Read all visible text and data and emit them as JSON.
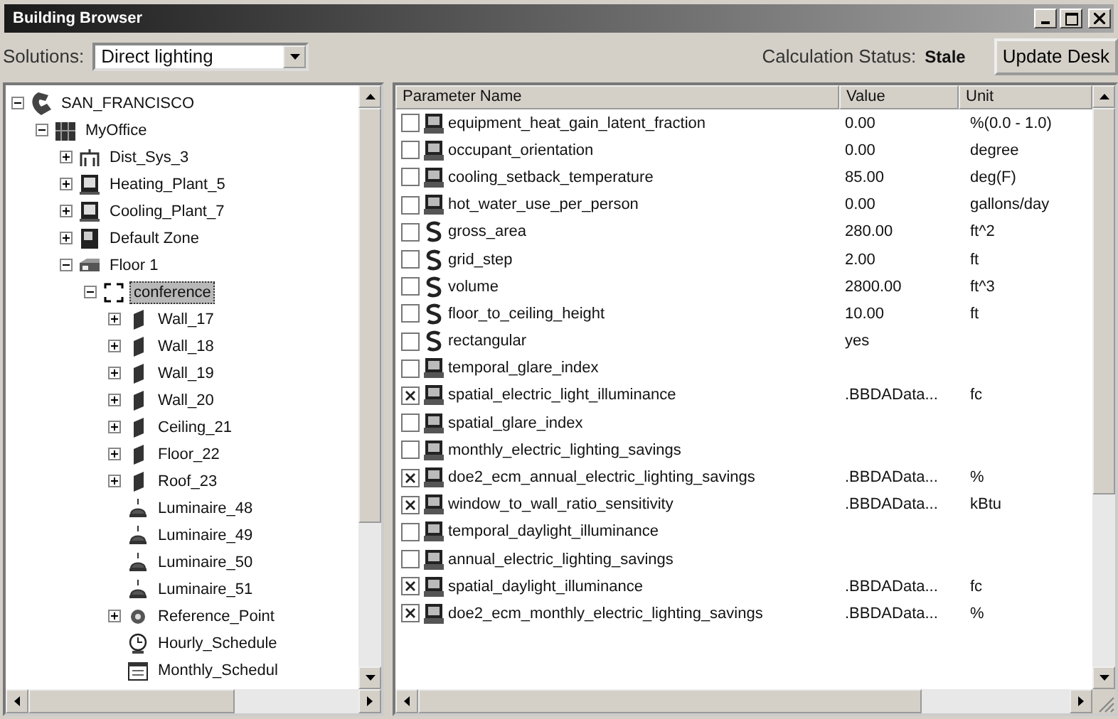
{
  "window": {
    "title": "Building Browser"
  },
  "toolbar": {
    "solutions_label": "Solutions:",
    "solutions_value": "Direct lighting",
    "status_label": "Calculation Status:",
    "status_value": "Stale",
    "update_button": "Update Desk"
  },
  "tree": [
    {
      "label": "SAN_FRANCISCO",
      "kind": "city",
      "expanded": true,
      "selected": false,
      "children": [
        {
          "label": "MyOffice",
          "kind": "building",
          "expanded": true,
          "selected": false,
          "children": [
            {
              "label": "Dist_Sys_3",
              "kind": "system",
              "expanded": false,
              "selected": false
            },
            {
              "label": "Heating_Plant_5",
              "kind": "plant",
              "expanded": false,
              "selected": false
            },
            {
              "label": "Cooling_Plant_7",
              "kind": "plant",
              "expanded": false,
              "selected": false
            },
            {
              "label": "Default Zone",
              "kind": "zone",
              "expanded": false,
              "selected": false
            },
            {
              "label": "Floor 1",
              "kind": "floor",
              "expanded": true,
              "selected": false,
              "children": [
                {
                  "label": "conference",
                  "kind": "space",
                  "expanded": true,
                  "selected": true,
                  "children": [
                    {
                      "label": "Wall_17",
                      "kind": "surface",
                      "expanded": false,
                      "selected": false
                    },
                    {
                      "label": "Wall_18",
                      "kind": "surface",
                      "expanded": false,
                      "selected": false
                    },
                    {
                      "label": "Wall_19",
                      "kind": "surface",
                      "expanded": false,
                      "selected": false
                    },
                    {
                      "label": "Wall_20",
                      "kind": "surface",
                      "expanded": false,
                      "selected": false
                    },
                    {
                      "label": "Ceiling_21",
                      "kind": "surface",
                      "expanded": false,
                      "selected": false
                    },
                    {
                      "label": "Floor_22",
                      "kind": "surface",
                      "expanded": false,
                      "selected": false
                    },
                    {
                      "label": "Roof_23",
                      "kind": "surface",
                      "expanded": false,
                      "selected": false
                    },
                    {
                      "label": "Luminaire_48",
                      "kind": "luminaire",
                      "selected": false
                    },
                    {
                      "label": "Luminaire_49",
                      "kind": "luminaire",
                      "selected": false
                    },
                    {
                      "label": "Luminaire_50",
                      "kind": "luminaire",
                      "selected": false
                    },
                    {
                      "label": "Luminaire_51",
                      "kind": "luminaire",
                      "selected": false
                    },
                    {
                      "label": "Reference_Point",
                      "kind": "refpoint",
                      "expanded": false,
                      "selected": false
                    },
                    {
                      "label": "Hourly_Schedule",
                      "kind": "schedule",
                      "selected": false
                    },
                    {
                      "label": "Monthly_Schedul",
                      "kind": "calendar",
                      "selected": false
                    }
                  ]
                }
              ]
            }
          ]
        }
      ]
    }
  ],
  "table": {
    "columns": [
      "Parameter Name",
      "Value",
      "Unit"
    ],
    "rows": [
      {
        "name": "equipment_heat_gain_latent_fraction",
        "value": "0.00",
        "unit": "%(0.0 - 1.0)",
        "kind": "input",
        "checked": false
      },
      {
        "name": "occupant_orientation",
        "value": "0.00",
        "unit": "degree",
        "kind": "input",
        "checked": false
      },
      {
        "name": "cooling_setback_temperature",
        "value": "85.00",
        "unit": "deg(F)",
        "kind": "input",
        "checked": false
      },
      {
        "name": "hot_water_use_per_person",
        "value": "0.00",
        "unit": "gallons/day",
        "kind": "input",
        "checked": false
      },
      {
        "name": "gross_area",
        "value": "280.00",
        "unit": "ft^2",
        "kind": "geometry",
        "checked": false
      },
      {
        "name": "grid_step",
        "value": "2.00",
        "unit": "ft",
        "kind": "geometry",
        "checked": false
      },
      {
        "name": "volume",
        "value": "2800.00",
        "unit": "ft^3",
        "kind": "geometry",
        "checked": false
      },
      {
        "name": "floor_to_ceiling_height",
        "value": "10.00",
        "unit": "ft",
        "kind": "geometry",
        "checked": false
      },
      {
        "name": "rectangular",
        "value": "yes",
        "kind": "geometry",
        "checked": false
      },
      {
        "name": "temporal_glare_index",
        "kind": "input",
        "checked": false
      },
      {
        "name": "spatial_electric_light_illuminance",
        "value": ".BBDAData...",
        "unit": "fc",
        "kind": "input",
        "checked": true
      },
      {
        "name": "spatial_glare_index",
        "kind": "input",
        "checked": false
      },
      {
        "name": "monthly_electric_lighting_savings",
        "kind": "input",
        "checked": false
      },
      {
        "name": "doe2_ecm_annual_electric_lighting_savings",
        "value": ".BBDAData...",
        "unit": "%",
        "kind": "input",
        "checked": true
      },
      {
        "name": "window_to_wall_ratio_sensitivity",
        "value": ".BBDAData...",
        "unit": "kBtu",
        "kind": "input",
        "checked": true
      },
      {
        "name": "temporal_daylight_illuminance",
        "kind": "input",
        "checked": false
      },
      {
        "name": "annual_electric_lighting_savings",
        "kind": "input",
        "checked": false
      },
      {
        "name": "spatial_daylight_illuminance",
        "value": ".BBDAData...",
        "unit": "fc",
        "kind": "input",
        "checked": true
      },
      {
        "name": "doe2_ecm_monthly_electric_lighting_savings",
        "value": ".BBDAData...",
        "unit": "%",
        "kind": "input",
        "checked": true
      }
    ]
  }
}
